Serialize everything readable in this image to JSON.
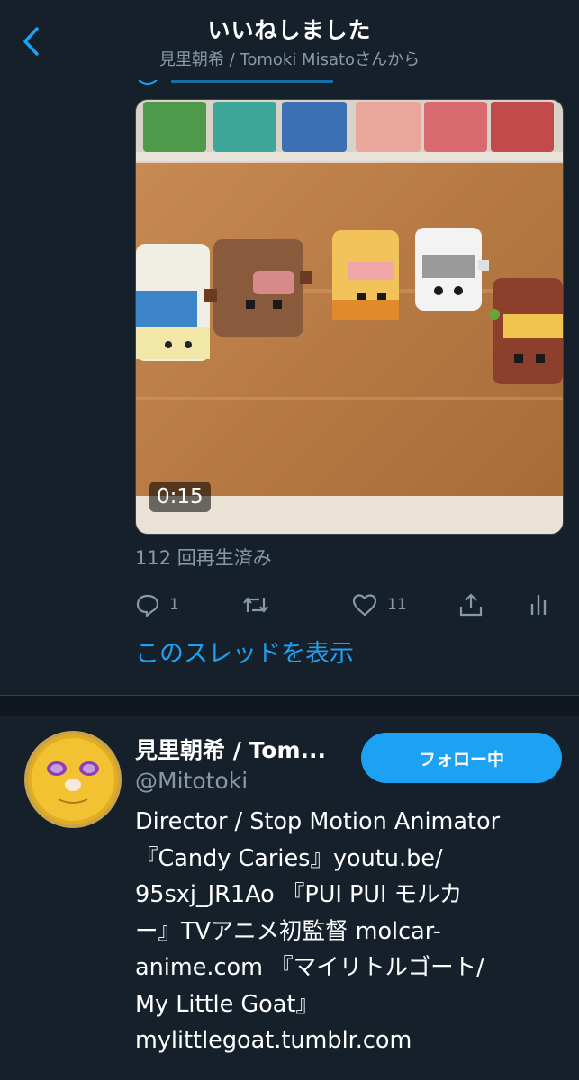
{
  "header": {
    "title": "いいねしました",
    "subtitle": "見里朝希 / Tomoki Misatoさんから"
  },
  "colors": {
    "background": "#15202b",
    "accent": "#1da1f2",
    "muted": "#8899a6",
    "border": "#38444d"
  },
  "tweet": {
    "video_duration": "0:15",
    "views": "112 回再生済み",
    "actions": {
      "reply": {
        "icon": "reply-icon",
        "count": "1"
      },
      "retweet": {
        "icon": "retweet-icon",
        "count": ""
      },
      "like": {
        "icon": "heart-icon",
        "count": "11"
      },
      "share": {
        "icon": "share-icon"
      },
      "analytics": {
        "icon": "analytics-icon"
      }
    },
    "thread_link": "このスレッドを表示"
  },
  "user": {
    "name": "見里朝希 / Tom...",
    "handle": "@Mitotoki",
    "follow_button": "フォロー中",
    "bio_lines": [
      "Director / Stop Motion Animator",
      "『Candy Caries』youtu.be/",
      "95sxj_JR1Ao 『PUI PUI モルカ",
      "ー』TVアニメ初監督 molcar-",
      "anime.com 『マイリトルゴート/",
      "My Little Goat』",
      "mylittlegoat.tumblr.com"
    ]
  }
}
